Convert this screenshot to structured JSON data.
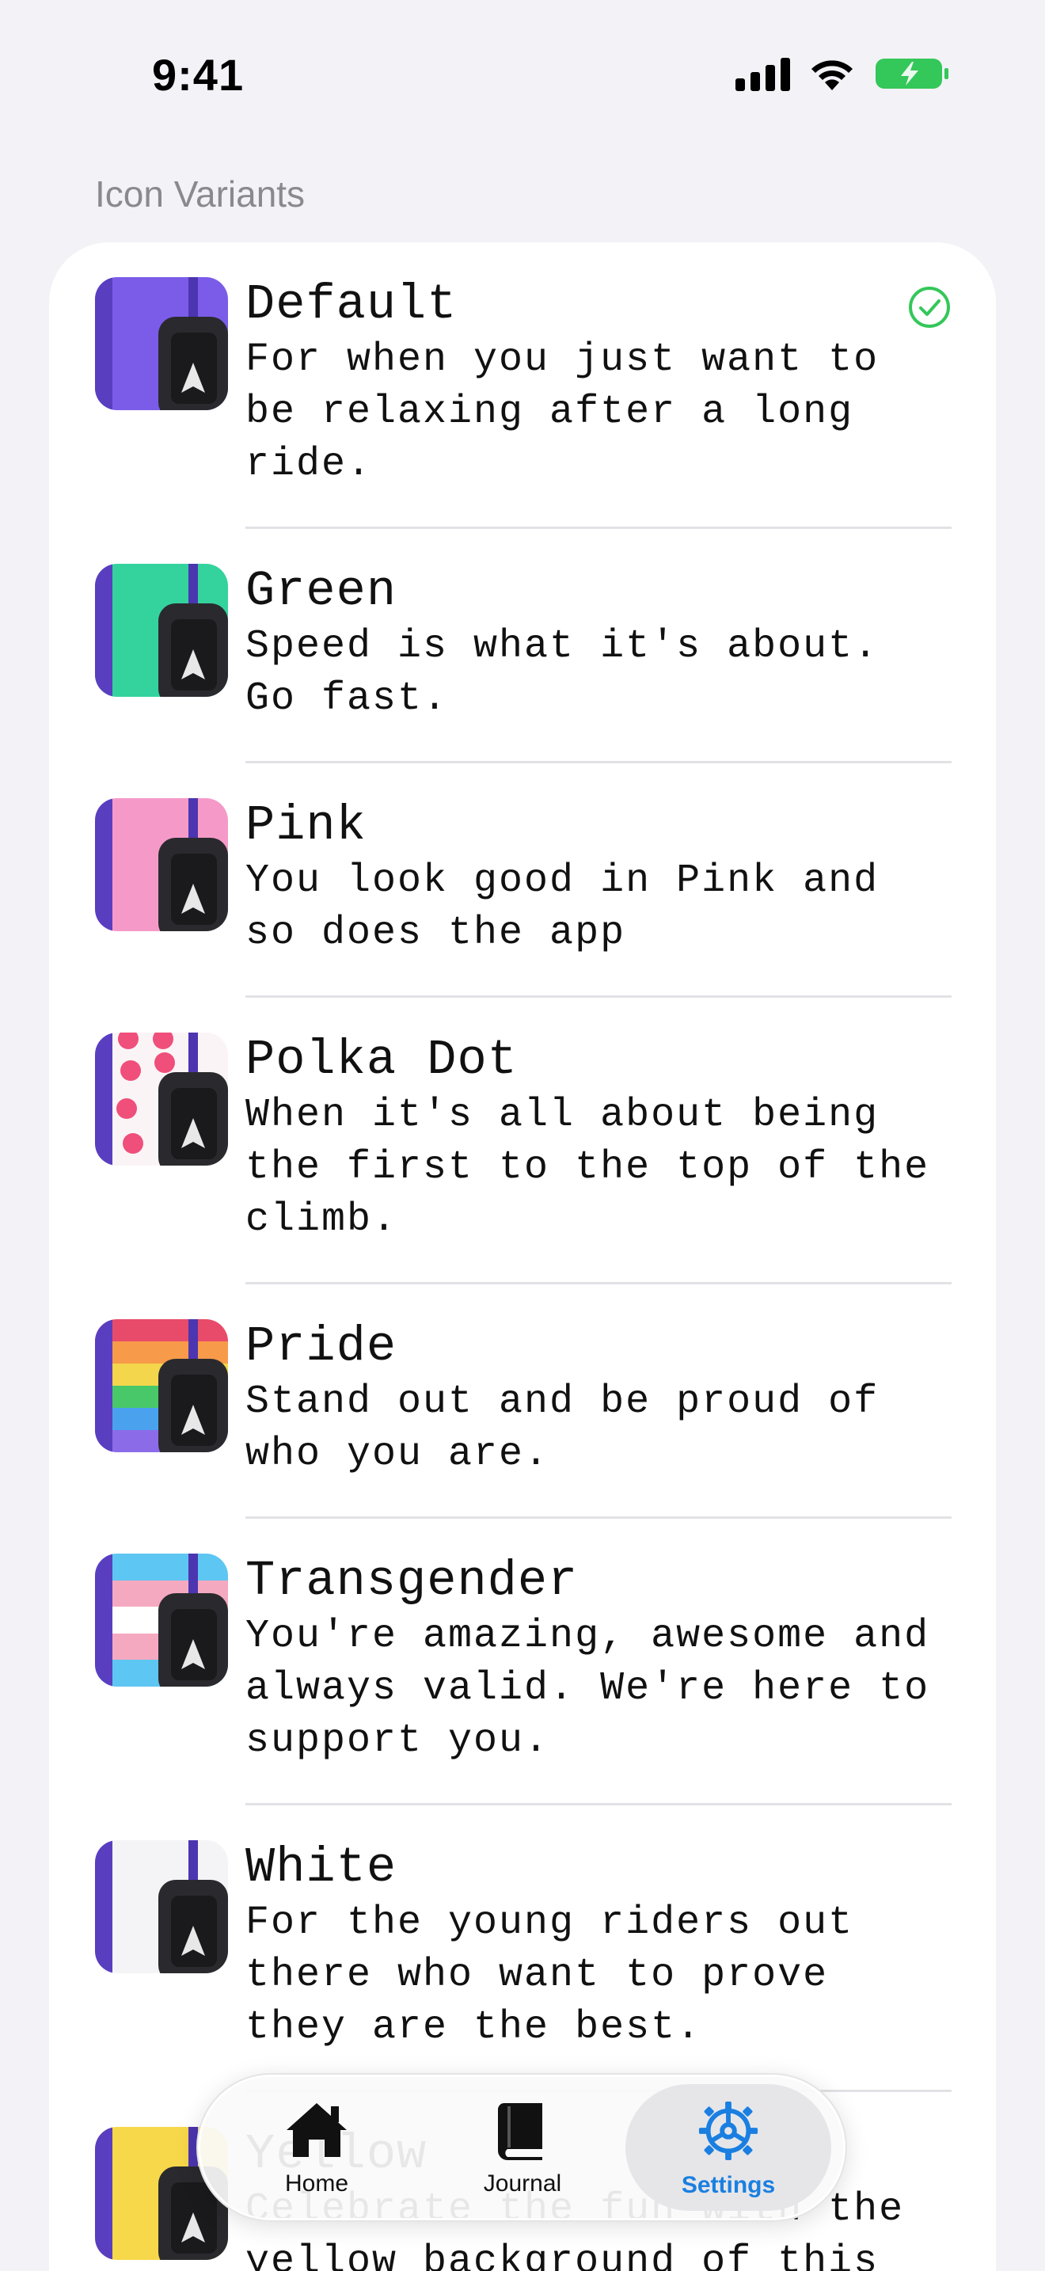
{
  "status_bar": {
    "time": "9:41"
  },
  "section": {
    "header": "Icon Variants"
  },
  "variants": [
    {
      "title": "Default",
      "description": "For when you just want to\nbe relaxing after a long\nride.",
      "selected": true
    },
    {
      "title": "Green",
      "description": "Speed is what it's about.\nGo fast."
    },
    {
      "title": "Pink",
      "description": "You look good in Pink and\nso does the app"
    },
    {
      "title": "Polka Dot",
      "description": "When it's all about being\nthe first to the top of the\nclimb."
    },
    {
      "title": "Pride",
      "description": "Stand out and be proud of\nwho you are."
    },
    {
      "title": "Transgender",
      "description": "You're amazing, awesome and\nalways valid. We're here to\nsupport you."
    },
    {
      "title": "White",
      "description": "For the young riders out\nthere who want to prove\nthey are the best."
    },
    {
      "title": "Yellow",
      "description": "Celebrate the fun with the\nyellow background of this"
    }
  ],
  "tab_bar": {
    "home": "Home",
    "journal": "Journal",
    "settings": "Settings",
    "active": "settings"
  },
  "colors": {
    "accent": "#1a7fe0",
    "check": "#34c759",
    "background": "#f2f2f7",
    "purple": "#6b4fd8"
  }
}
